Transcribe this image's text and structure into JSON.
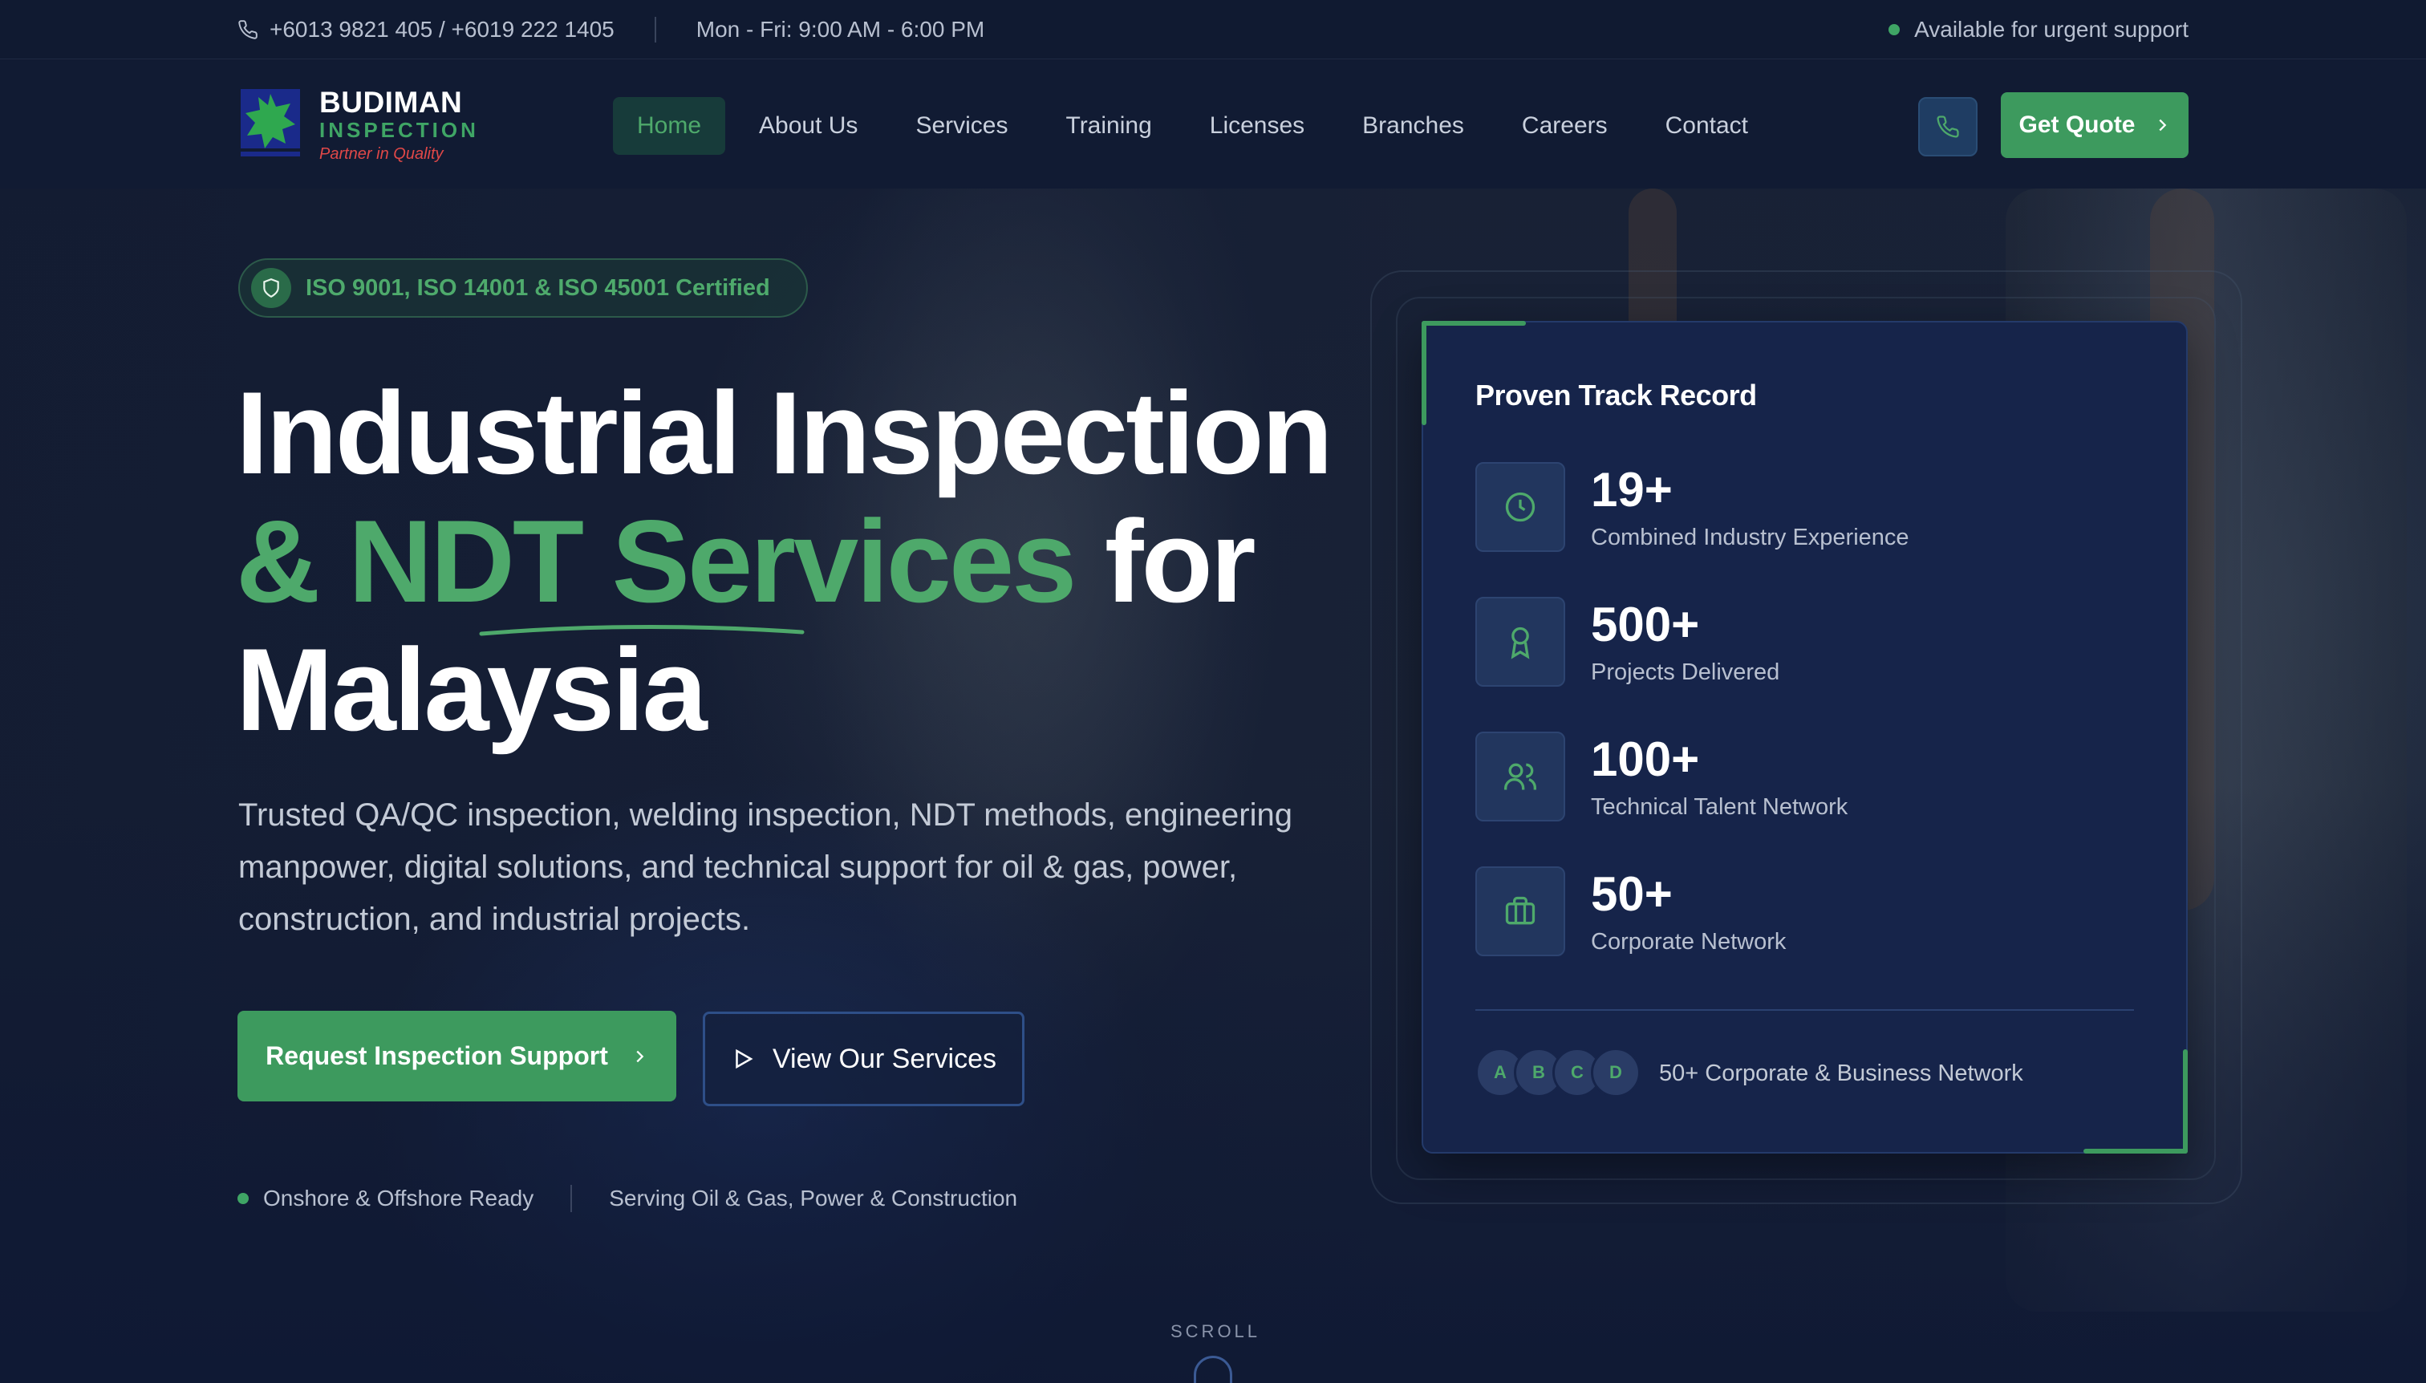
{
  "topbar": {
    "phone": "+6013 9821 405 / +6019 222 1405",
    "hours": "Mon - Fri: 9:00 AM - 6:00 PM",
    "availability": "Available for urgent support"
  },
  "brand": {
    "name": "BUDIMAN",
    "sub": "INSPECTION",
    "tagline": "Partner in Quality"
  },
  "nav": {
    "items": [
      {
        "label": "Home",
        "active": true
      },
      {
        "label": "About Us"
      },
      {
        "label": "Services"
      },
      {
        "label": "Training"
      },
      {
        "label": "Licenses"
      },
      {
        "label": "Branches"
      },
      {
        "label": "Careers"
      },
      {
        "label": "Contact"
      }
    ],
    "quote_label": "Get Quote"
  },
  "hero": {
    "badge": "ISO 9001, ISO 14001 & ISO 45001 Certified",
    "headline_line1": "Industrial Inspection",
    "headline_green": "& NDT Services",
    "headline_for": "for",
    "headline_line3": "Malaysia",
    "lead": "Trusted QA/QC inspection, welding inspection, NDT methods, engineering manpower, digital solutions, and technical support for oil & gas, power, construction, and industrial projects.",
    "primary_cta": "Request Inspection Support",
    "secondary_cta": "View Our Services",
    "feature1": "Onshore & Offshore Ready",
    "feature2": "Serving Oil & Gas, Power & Construction",
    "scroll": "SCROLL"
  },
  "card": {
    "title": "Proven Track Record",
    "stats": [
      {
        "value": "19+",
        "label": "Combined Industry Experience",
        "icon": "clock-icon"
      },
      {
        "value": "500+",
        "label": "Projects Delivered",
        "icon": "award-icon"
      },
      {
        "value": "100+",
        "label": "Technical Talent Network",
        "icon": "users-icon"
      },
      {
        "value": "50+",
        "label": "Corporate Network",
        "icon": "briefcase-icon"
      }
    ],
    "avatars": [
      "A",
      "B",
      "C",
      "D"
    ],
    "network": "50+ Corporate & Business Network"
  },
  "colors": {
    "accent": "#3d9a5e",
    "accent_text": "#4ea96b",
    "background": "#111a30",
    "card": "#16244a"
  }
}
